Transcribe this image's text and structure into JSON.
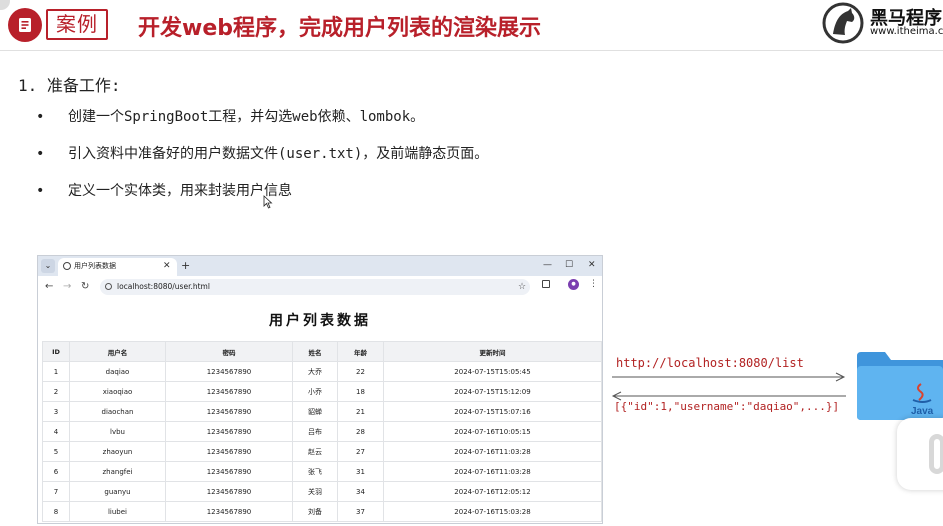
{
  "header": {
    "tag_label": "案例",
    "title": "开发web程序，完成用户列表的渲染展示",
    "brand_name": "黑马程序",
    "brand_url": "www.itheima.c"
  },
  "section": {
    "heading": "1. 准备工作:",
    "bullets": [
      "创建一个SpringBoot工程，并勾选web依赖、lombok。",
      "引入资料中准备好的用户数据文件(user.txt)，及前端静态页面。",
      "定义一个实体类，用来封装用户信息"
    ]
  },
  "browser": {
    "tab_title": "用户列表数据",
    "url": "localhost:8080/user.html",
    "page_title": "用户列表数据",
    "table": {
      "columns": [
        "ID",
        "用户名",
        "密码",
        "姓名",
        "年龄",
        "更新时间"
      ],
      "rows": [
        [
          "1",
          "daqiao",
          "1234567890",
          "大乔",
          "22",
          "2024-07-15T15:05:45"
        ],
        [
          "2",
          "xiaoqiao",
          "1234567890",
          "小乔",
          "18",
          "2024-07-15T15:12:09"
        ],
        [
          "3",
          "diaochan",
          "1234567890",
          "貂蝉",
          "21",
          "2024-07-15T15:07:16"
        ],
        [
          "4",
          "lvbu",
          "1234567890",
          "吕布",
          "28",
          "2024-07-16T10:05:15"
        ],
        [
          "5",
          "zhaoyun",
          "1234567890",
          "赵云",
          "27",
          "2024-07-16T11:03:28"
        ],
        [
          "6",
          "zhangfei",
          "1234567890",
          "张飞",
          "31",
          "2024-07-16T11:03:28"
        ],
        [
          "7",
          "guanyu",
          "1234567890",
          "关羽",
          "34",
          "2024-07-16T12:05:12"
        ],
        [
          "8",
          "liubei",
          "1234567890",
          "刘备",
          "37",
          "2024-07-16T15:03:28"
        ]
      ]
    }
  },
  "diagram": {
    "request_url": "http://localhost:8080/list",
    "response_json": "[{\"id\":1,\"username\":\"daqiao\",...}]",
    "server_icon_label": "Java"
  },
  "colors": {
    "accent": "#b8202a",
    "link_red": "#b22222",
    "folder_blue": "#4aa3e8"
  }
}
